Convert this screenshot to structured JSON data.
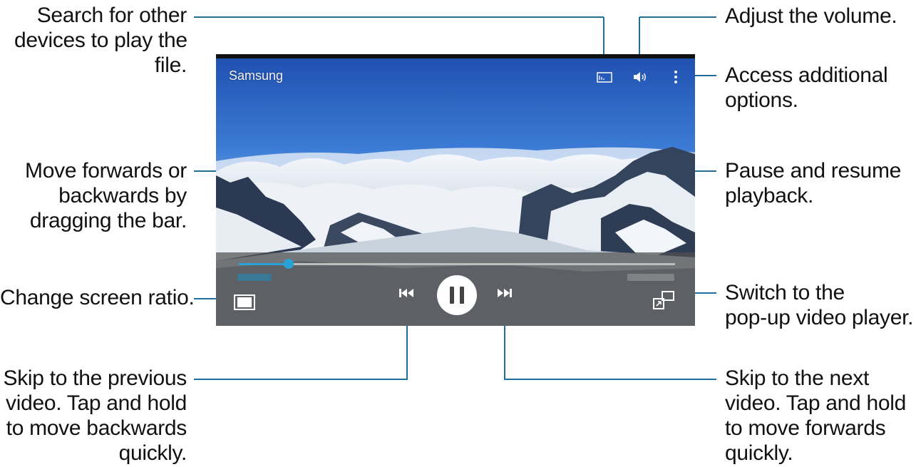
{
  "callouts": {
    "search_devices": [
      "Search for other",
      "devices to play the",
      "file."
    ],
    "adjust_volume": [
      "Adjust the volume."
    ],
    "additional_options": [
      "Access additional",
      "options."
    ],
    "move_bar": [
      "Move forwards or",
      "backwards by",
      "dragging the bar."
    ],
    "pause_resume": [
      "Pause and resume",
      "playback."
    ],
    "screen_ratio": [
      "Change screen ratio."
    ],
    "popup_player": [
      "Switch to the",
      "pop-up video player."
    ],
    "skip_previous": [
      "Skip to the previous",
      "video. Tap and hold",
      "to move backwards",
      "quickly."
    ],
    "skip_next": [
      "Skip to the next",
      "video. Tap and hold",
      "to move forwards",
      "quickly."
    ]
  },
  "player": {
    "title": "Samsung",
    "progress_fraction": 0.115,
    "playing": true
  },
  "colors": {
    "leader_line": "#1f6e9c",
    "accent": "#29a3d6",
    "controls_bg": "#505050"
  },
  "icons": {
    "cast": "screen-mirroring-icon",
    "volume": "volume-icon",
    "more": "more-options-icon",
    "ratio": "screen-ratio-icon",
    "prev": "skip-previous-icon",
    "pause": "pause-icon",
    "next": "skip-next-icon",
    "popup": "popup-player-icon"
  }
}
